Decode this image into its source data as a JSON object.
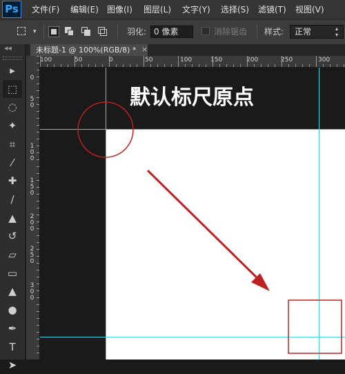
{
  "app": {
    "logo": "Ps"
  },
  "menu": [
    "文件(F)",
    "编辑(E)",
    "图像(I)",
    "图层(L)",
    "文字(Y)",
    "选择(S)",
    "滤镜(T)",
    "视图(V)"
  ],
  "options_bar": {
    "feather_label": "羽化:",
    "feather_value": "0 像素",
    "antialias_label": "消除锯齿",
    "style_label": "样式:",
    "style_value": "正常"
  },
  "document": {
    "tab_title": "未标题-1 @ 100%(RGB/8) *",
    "close_glyph": "×"
  },
  "ruler": {
    "h_labels": [
      "100",
      "50",
      "0",
      "50",
      "100",
      "150",
      "200",
      "250",
      "300"
    ],
    "v_labels": [
      "5\n0",
      "0",
      "5\n0",
      "1\n0\n0",
      "1\n5\n0",
      "2\n0\n0",
      "2\n5\n0",
      "3\n0\n0"
    ]
  },
  "annotation": "默认标尺原点",
  "colors": {
    "guide": "#3fd7e8",
    "highlight": "#c0201f",
    "canvas": "#ffffff",
    "pasteboard": "#1a1a1a"
  },
  "tools": [
    "move-icon",
    "rect-marquee-icon",
    "lasso-icon",
    "magic-wand-icon",
    "crop-icon",
    "eyedropper-icon",
    "healing-brush-icon",
    "brush-icon",
    "clone-stamp-icon",
    "history-brush-icon",
    "eraser-icon",
    "gradient-icon",
    "blur-icon",
    "dodge-icon",
    "pen-icon",
    "type-icon",
    "path-select-icon"
  ]
}
